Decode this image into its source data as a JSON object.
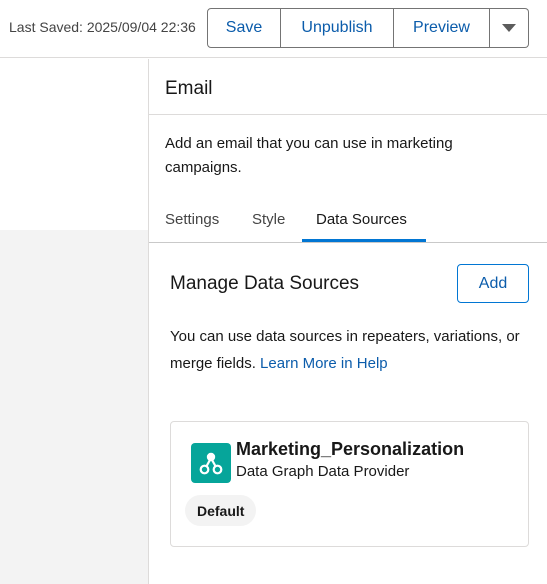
{
  "toolbar": {
    "last_saved": "Last Saved: 2025/09/04 22:36",
    "save_label": "Save",
    "unpublish_label": "Unpublish",
    "preview_label": "Preview",
    "more_icon": "chevron-down-icon"
  },
  "panel": {
    "title": "Email",
    "description": "Add an email that you can use in marketing campaigns.",
    "tabs": [
      {
        "label": "Settings",
        "active": false
      },
      {
        "label": "Style",
        "active": false
      },
      {
        "label": "Data Sources",
        "active": true
      }
    ]
  },
  "data_sources": {
    "heading": "Manage Data Sources",
    "add_label": "Add",
    "info_text": "You can use data sources in repeaters, variations, or merge fields.",
    "help_link": "Learn More in Help",
    "items": [
      {
        "name": "Marketing_Personalization",
        "type": "Data Graph Data Provider",
        "badge": "Default",
        "icon": "data-graph-icon",
        "icon_color": "#06a59a"
      }
    ]
  },
  "colors": {
    "accent": "#0176d3",
    "link": "#0b5cab",
    "canvas": "#f3f3f3"
  }
}
